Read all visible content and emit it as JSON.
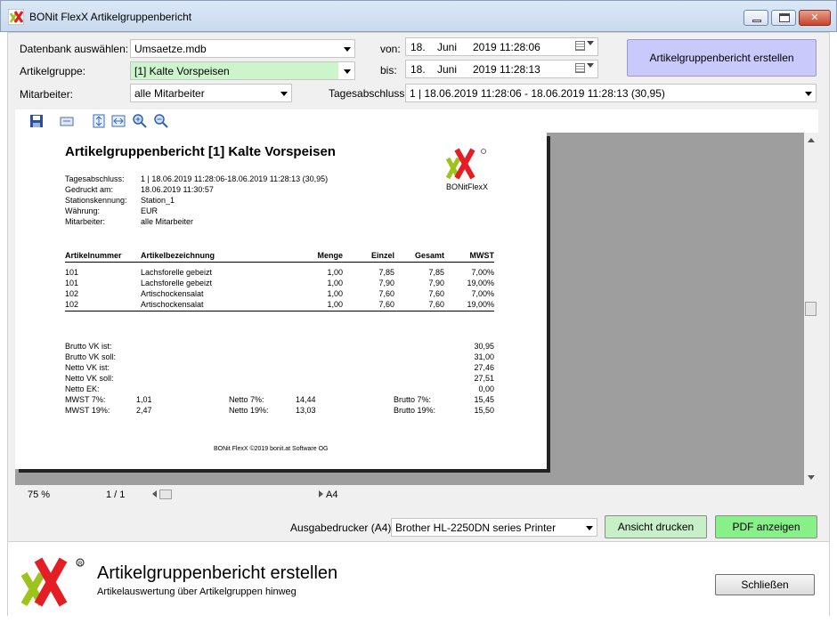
{
  "window": {
    "title": "BONit FlexX Artikelgruppenbericht"
  },
  "form": {
    "datenbank_label": "Datenbank auswählen:",
    "datenbank_value": "Umsaetze.mdb",
    "artikelgruppe_label": "Artikelgruppe:",
    "artikelgruppe_value": "[1] Kalte Vorspeisen",
    "mitarbeiter_label": "Mitarbeiter:",
    "mitarbeiter_value": "alle Mitarbeiter",
    "von_label": "von:",
    "von_day": "18.",
    "von_month": "Juni",
    "von_rest": "2019 11:28:06",
    "bis_label": "bis:",
    "bis_day": "18.",
    "bis_month": "Juni",
    "bis_rest": "2019 11:28:13",
    "tagesabschluss_label": "Tagesabschluss:",
    "tagesabschluss_value": "1 | 18.06.2019 11:28:06 - 18.06.2019 11:28:13 (30,95)",
    "create_button": "Artikelgruppenbericht erstellen"
  },
  "toolbar": {
    "icons": [
      "save-icon",
      "export-icon",
      "fit-page-icon",
      "fit-width-icon",
      "zoom-in-icon",
      "zoom-out-icon"
    ]
  },
  "report": {
    "title": "Artikelgruppenbericht [1] Kalte Vorspeisen",
    "logo_text": "BONitFlexX",
    "meta": [
      {
        "label": "Tagesabschluss:",
        "value": "1 | 18.06.2019 11:28:06-18.06.2019 11:28:13 (30,95)"
      },
      {
        "label": "Gedruckt am:",
        "value": "18.06.2019 11:30:57"
      },
      {
        "label": "Stationskennung:",
        "value": "Station_1"
      },
      {
        "label": "Währung:",
        "value": "EUR"
      },
      {
        "label": "Mitarbeiter:",
        "value": "alle Mitarbeiter"
      }
    ],
    "columns": [
      "Artikelnummer",
      "Artikelbezeichnung",
      "Menge",
      "Einzel",
      "Gesamt",
      "MWST"
    ],
    "rows": [
      [
        "101",
        "Lachsforelle gebeizt",
        "1,00",
        "7,85",
        "7,85",
        "7,00%"
      ],
      [
        "101",
        "Lachsforelle gebeizt",
        "1,00",
        "7,90",
        "7,90",
        "19,00%"
      ],
      [
        "102",
        "Artischockensalat",
        "1,00",
        "7,60",
        "7,60",
        "7,00%"
      ],
      [
        "102",
        "Artischockensalat",
        "1,00",
        "7,60",
        "7,60",
        "19,00%"
      ]
    ],
    "totals": [
      {
        "label": "Brutto VK ist:",
        "value": "30,95"
      },
      {
        "label": "Brutto VK soll:",
        "value": "31,00"
      },
      {
        "label": "Netto VK ist:",
        "value": "27,46"
      },
      {
        "label": "Netto VK soll:",
        "value": "27,51"
      },
      {
        "label": "Netto EK:",
        "value": "0,00"
      }
    ],
    "tax": [
      {
        "label": "MWST 7%:",
        "value": "1,01",
        "netto_label": "Netto 7%:",
        "netto": "14,44",
        "brutto_label": "Brutto 7%:",
        "brutto": "15,45"
      },
      {
        "label": "MWST 19%:",
        "value": "2,47",
        "netto_label": "Netto 19%:",
        "netto": "13,03",
        "brutto_label": "Brutto 19%:",
        "brutto": "15,50"
      }
    ],
    "footer": "BONit FlexX ©2019 bonit.at Software OG"
  },
  "status": {
    "zoom": "75 %",
    "page": "1 / 1",
    "paper": "A4"
  },
  "print": {
    "printer_label": "Ausgabedrucker (A4):",
    "printer_value": "Brother HL-2250DN series Printer",
    "print_button": "Ansicht drucken",
    "pdf_button": "PDF anzeigen"
  },
  "footer": {
    "title": "Artikelgruppenbericht erstellen",
    "subtitle": "Artikelauswertung über Artikelgruppen hinweg",
    "close_button": "Schließen"
  },
  "colors": {
    "accent_purple": "#c9c9fb",
    "green_light": "#c8f0c8",
    "green_strong": "#88f088",
    "logo_green": "#9dc31c",
    "logo_red": "#e31e24"
  }
}
